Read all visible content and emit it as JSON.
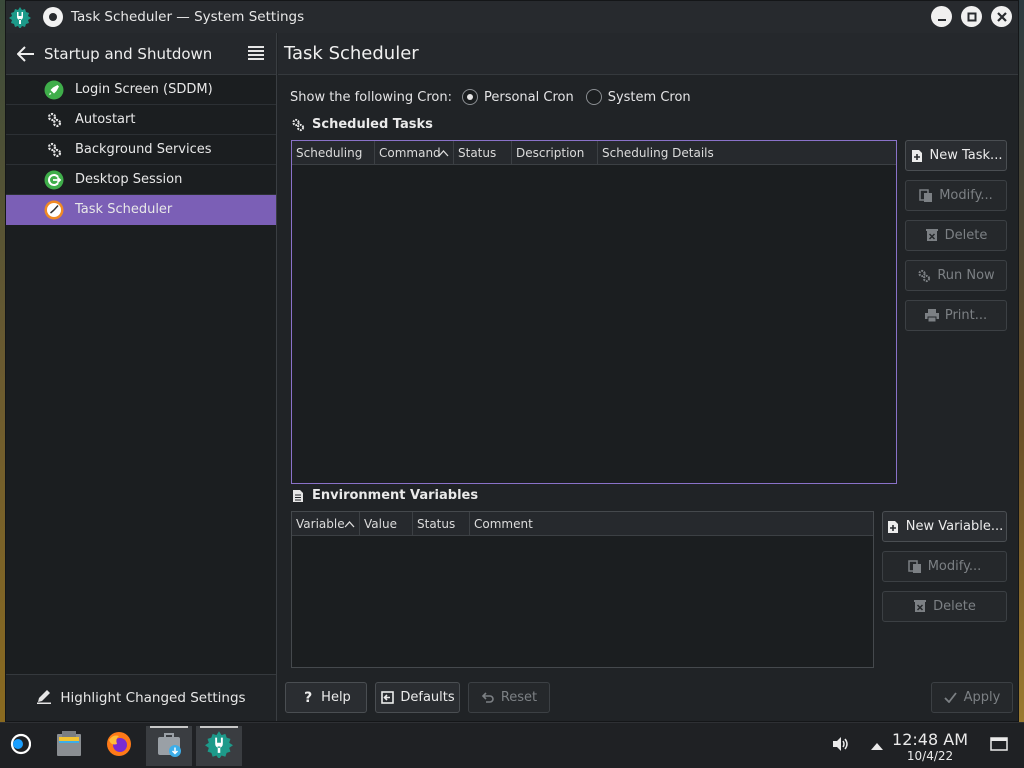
{
  "window": {
    "title": "Task Scheduler — System Settings"
  },
  "sidebar": {
    "header": "Startup and Shutdown",
    "items": [
      {
        "label": "Login Screen (SDDM)",
        "icon": "rocket-icon"
      },
      {
        "label": "Autostart",
        "icon": "gears-icon"
      },
      {
        "label": "Background Services",
        "icon": "gears-icon"
      },
      {
        "label": "Desktop Session",
        "icon": "session-icon"
      },
      {
        "label": "Task Scheduler",
        "icon": "clock-icon",
        "active": true
      }
    ],
    "footer": "Highlight Changed Settings"
  },
  "main": {
    "title": "Task Scheduler",
    "cron": {
      "label": "Show the following Cron:",
      "personal": "Personal Cron",
      "system": "System Cron",
      "selected": "Personal Cron"
    },
    "tasks": {
      "title": "Scheduled Tasks",
      "columns": [
        "Scheduling",
        "Command",
        "Status",
        "Description",
        "Scheduling Details"
      ],
      "sorted_column": "Command",
      "rows": [],
      "buttons": {
        "new": "New Task...",
        "modify": "Modify...",
        "delete": "Delete",
        "run": "Run Now",
        "print": "Print..."
      }
    },
    "env": {
      "title": "Environment Variables",
      "columns": [
        "Variable",
        "Value",
        "Status",
        "Comment"
      ],
      "sorted_column": "Variable",
      "rows": [],
      "buttons": {
        "new": "New Variable...",
        "modify": "Modify...",
        "delete": "Delete"
      }
    },
    "footer": {
      "help": "Help",
      "defaults": "Defaults",
      "reset": "Reset",
      "apply": "Apply"
    }
  },
  "taskbar": {
    "time": "12:48 AM",
    "date": "10/4/22"
  },
  "colors": {
    "accent": "#7b5fb6",
    "focus_border": "#8a72c9",
    "window_bg": "#202326"
  }
}
